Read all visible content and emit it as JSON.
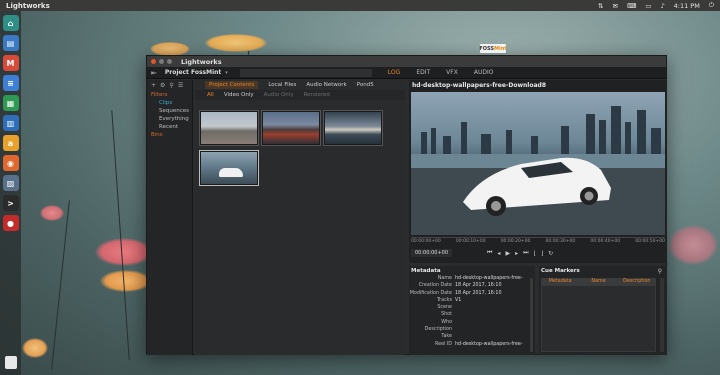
{
  "desktop": {
    "app_title": "Lightworks",
    "tray": {
      "network": "⇅",
      "mail": "✉",
      "keyboard": "⌨",
      "battery": "▭",
      "volume": "♪",
      "time": "4:11 PM",
      "power": "⏻"
    }
  },
  "launcher": {
    "items": [
      {
        "name": "home-icon",
        "glyph": "⌂",
        "color": "#2f8f86"
      },
      {
        "name": "files-icon",
        "glyph": "▤",
        "color": "#3a79c4"
      },
      {
        "name": "mail-icon",
        "glyph": "M",
        "color": "#d84a3a"
      },
      {
        "name": "docs-icon",
        "glyph": "≡",
        "color": "#3e7fd6"
      },
      {
        "name": "sheets-icon",
        "glyph": "▦",
        "color": "#2e9a52"
      },
      {
        "name": "files-blue-icon",
        "glyph": "▥",
        "color": "#2d6fb8"
      },
      {
        "name": "amazon-icon",
        "glyph": "a",
        "color": "#e8a12b"
      },
      {
        "name": "software-icon",
        "glyph": "◉",
        "color": "#e0672e"
      },
      {
        "name": "photos-icon",
        "glyph": "▨",
        "color": "#58708a"
      },
      {
        "name": "terminal-icon",
        "glyph": ">",
        "color": "#2b2b2b"
      },
      {
        "name": "lightworks-icon",
        "glyph": "●",
        "color": "#c42b2b"
      }
    ]
  },
  "window": {
    "title": "Lightworks",
    "logo_prefix": "FOSS",
    "logo_suffix": "Mint",
    "project_name": "Project FossMint",
    "modes": [
      "LOG",
      "EDIT",
      "VFX",
      "AUDIO"
    ],
    "active_mode": "LOG"
  },
  "nav": {
    "filters_label": "Filters",
    "items": [
      "Clips",
      "Sequences",
      "Everything",
      "Recent"
    ],
    "bins_label": "Bins"
  },
  "browser": {
    "tabs": [
      "Project Contents",
      "Local Files",
      "Audio Network",
      "Pond5"
    ],
    "filters": [
      "All",
      "Video Only",
      "Audio Only",
      "Rendered"
    ]
  },
  "viewer": {
    "title": "hd-desktop-wallpapers-free-Download8",
    "timecodes": [
      "00:00:00+00",
      "00:00:10+00",
      "00:00:20+00",
      "00:00:30+00",
      "00:00:40+00",
      "00:00:50+00"
    ],
    "current_tc": "00:00:00+00"
  },
  "metadata": {
    "title": "Metadata",
    "rows": [
      {
        "key": "Name",
        "value": "hd-desktop-wallpapers-free-"
      },
      {
        "key": "Creation Date",
        "value": "18 Apr 2017, 16:10"
      },
      {
        "key": "Modification Date",
        "value": "18 Apr 2017, 16:10"
      },
      {
        "key": "Tracks",
        "value": "V1"
      },
      {
        "key": "Scene",
        "value": ""
      },
      {
        "key": "Shot",
        "value": ""
      },
      {
        "key": "Who",
        "value": ""
      },
      {
        "key": "Description",
        "value": ""
      },
      {
        "key": "Take",
        "value": ""
      },
      {
        "key": "Reel ID",
        "value": "hd-desktop-wallpapers-free-"
      }
    ]
  },
  "cues": {
    "title": "Cue Markers",
    "columns": [
      "Metadata",
      "Name",
      "Description"
    ]
  }
}
